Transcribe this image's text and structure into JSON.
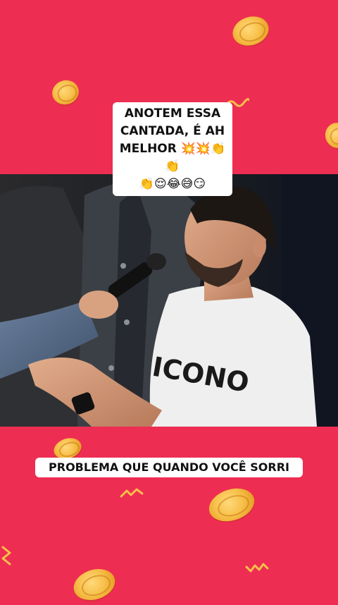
{
  "captions": {
    "top_line1": "ANOTEM ESSA",
    "top_line2": "CANTADA, É AH",
    "top_line3": "MELHOR 💥💥👏👏",
    "top_line4": "👏😌😂😅😏",
    "bottom": "PROBLEMA QUE QUANDO VOCÊ SORRI"
  },
  "video": {
    "shirt_text": "ICONO"
  },
  "colors": {
    "background": "#ee2d52",
    "coin": "#f7c04a",
    "caption_bg": "#ffffff"
  }
}
